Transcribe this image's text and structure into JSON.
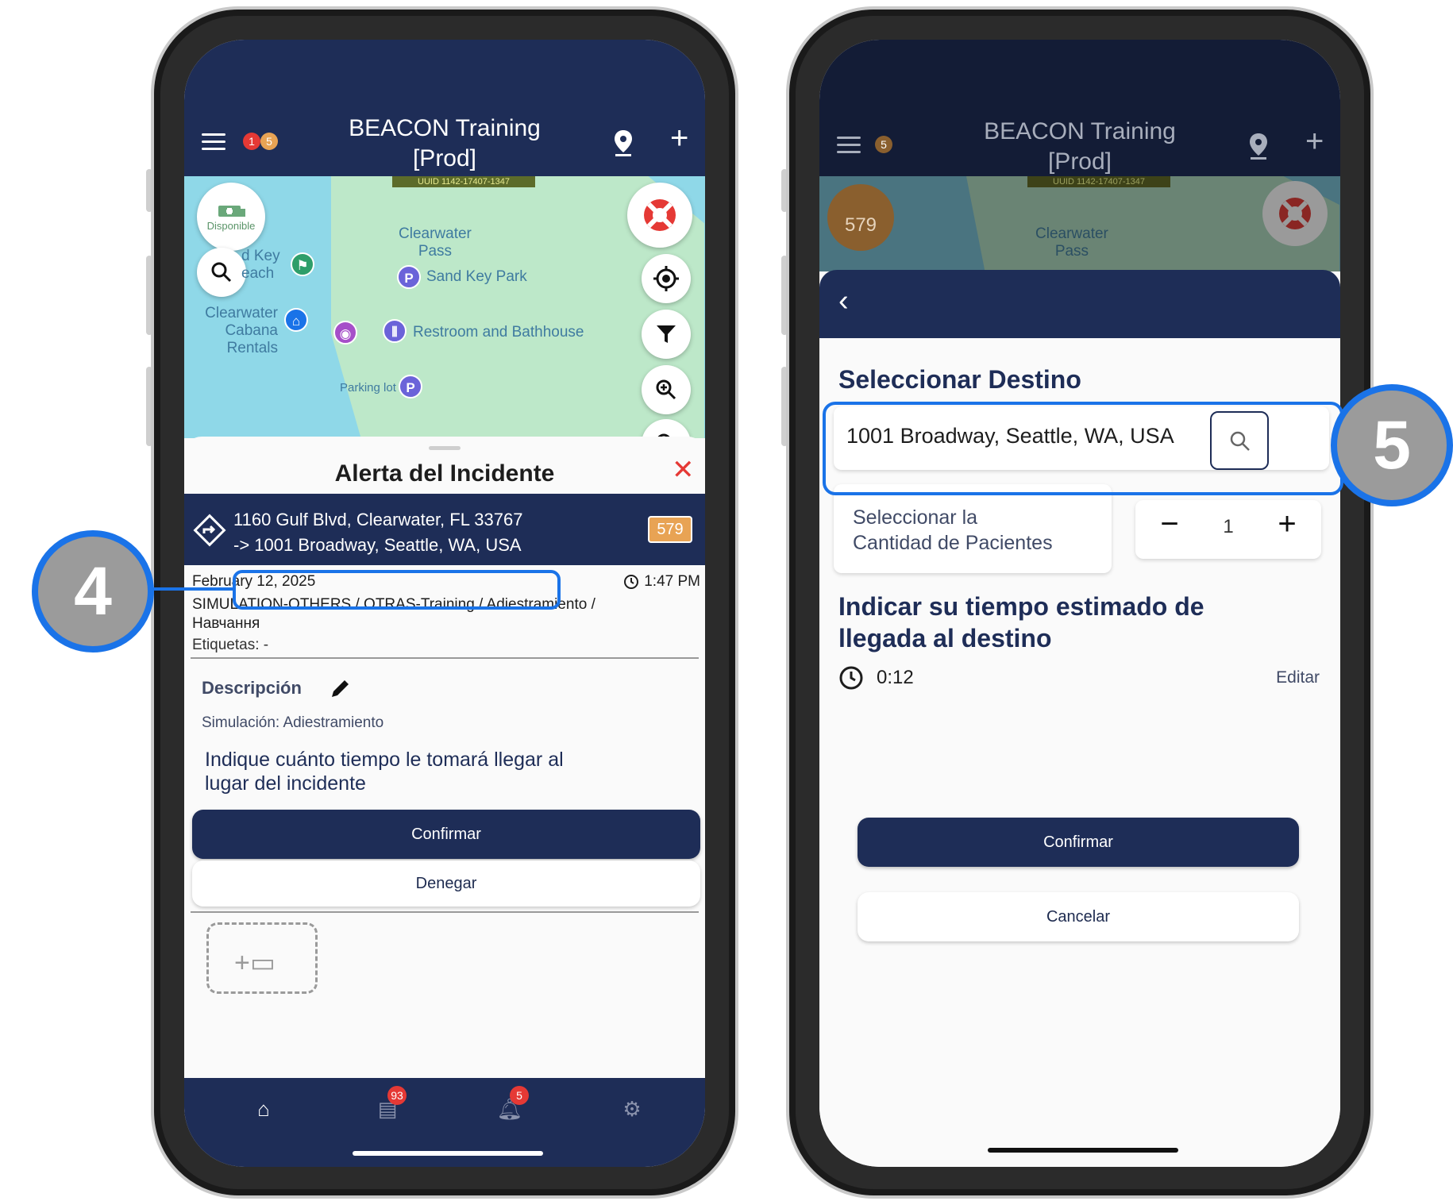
{
  "left_phone": {
    "header": {
      "title": "BEACON Training\n[Prod]",
      "badge_red": "1",
      "badge_orange": "5"
    },
    "map": {
      "uuid": "UUID 1142-17407-1347",
      "status_label": "Disponible",
      "labels": {
        "sand_key_beach": "d Key\neach",
        "clearwater_pass": "Clearwater\nPass",
        "sand_key_park": "Sand Key Park",
        "cabana": "Clearwater\nCabana Rentals",
        "restroom": "Restroom and Bathhouse",
        "parking": "Parking lot"
      }
    },
    "alert": {
      "title": "Alerta del Incidente",
      "origin": "1160 Gulf Blvd, Clearwater, FL 33767",
      "destination": "-> 1001 Broadway, Seattle, WA, USA",
      "unit": "579",
      "date": "February 12, 2025",
      "time": "1:47 PM",
      "type": "SIMULATION-OTHERS / OTRAS-Training / Adiestramiento /\nНавчання",
      "tags": "Etiquetas: -",
      "description_label": "Descripción",
      "description_text": "Simulación: Adiestramiento",
      "eta_prompt": "Indique cuánto tiempo le tomará llegar al\nlugar del incidente",
      "confirm": "Confirmar",
      "deny": "Denegar"
    },
    "tabs": {
      "messages_count": "93",
      "notifications_count": "5"
    },
    "callout": "4"
  },
  "right_phone": {
    "header": {
      "title": "BEACON Training\n[Prod]",
      "badge_orange": "5"
    },
    "map": {
      "uuid": "UUID 1142-17407-1347",
      "unit": "579",
      "label": "Clearwater\nPass"
    },
    "panel": {
      "section_title": "Seleccionar Destino",
      "destination_value": "1001 Broadway, Seattle, WA, USA",
      "patients_label": "Seleccionar la\nCantidad de Pacientes",
      "patients_minus": "−",
      "patients_value": "1",
      "patients_plus": "+",
      "eta_title": "Indicar su tiempo estimado de\nllegada al destino",
      "eta_value": "0:12",
      "edit": "Editar",
      "confirm": "Confirmar",
      "cancel": "Cancelar"
    },
    "callout": "5"
  },
  "colors": {
    "navy": "#1e2d57",
    "accent_blue": "#1a73e8",
    "danger_red": "#e53935",
    "unit_orange": "#e8a354"
  }
}
